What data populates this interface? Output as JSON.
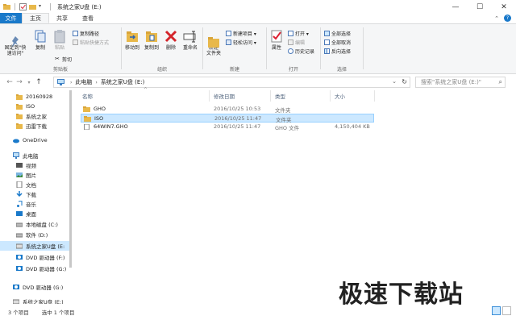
{
  "window": {
    "title": "系统之家U盘 (E:)",
    "controls": [
      "—",
      "☐",
      "✕"
    ]
  },
  "tabs": {
    "file": "文件",
    "home": "主页",
    "share": "共享",
    "view": "查看"
  },
  "ribbon": {
    "clipboard": {
      "group": "剪贴板",
      "pin": "固定到\"快\n速访问\"",
      "copy": "复制",
      "paste": "粘贴",
      "copy_path": "复制路径",
      "paste_shortcut": "粘贴快捷方式",
      "cut": "剪切"
    },
    "organize": {
      "group": "组织",
      "move_to": "移动到",
      "copy_to": "复制到",
      "delete": "删除",
      "rename": "重命名"
    },
    "new": {
      "group": "新建",
      "new_folder": "新建\n文件夹",
      "new_item": "新建项目 ▾",
      "easy_access": "轻松访问 ▾"
    },
    "open": {
      "group": "打开",
      "properties": "属性",
      "open": "打开 ▾",
      "edit": "编辑",
      "history": "历史记录"
    },
    "select": {
      "group": "选择",
      "select_all": "全部选择",
      "select_none": "全部取消",
      "invert": "反向选择"
    }
  },
  "address": {
    "crumbs": [
      "此电脑",
      "系统之家U盘 (E:)"
    ],
    "search_placeholder": "搜索\"系统之家U盘 (E:)\""
  },
  "nav": {
    "items": [
      {
        "label": "20160928",
        "icon": "folder-icon"
      },
      {
        "label": "ISO",
        "icon": "folder-icon"
      },
      {
        "label": "系统之家",
        "icon": "folder-icon"
      },
      {
        "label": "迅雷下载",
        "icon": "folder-icon"
      },
      {
        "label": "OneDrive",
        "icon": "cloud-icon"
      },
      {
        "label": "此电脑",
        "icon": "computer-icon"
      },
      {
        "label": "视频",
        "icon": "video-icon"
      },
      {
        "label": "图片",
        "icon": "pictures-icon"
      },
      {
        "label": "文档",
        "icon": "documents-icon"
      },
      {
        "label": "下载",
        "icon": "download-icon"
      },
      {
        "label": "音乐",
        "icon": "music-icon"
      },
      {
        "label": "桌面",
        "icon": "desktop-icon"
      },
      {
        "label": "本地磁盘 (C:)",
        "icon": "drive-icon"
      },
      {
        "label": "软件 (D:)",
        "icon": "drive-icon"
      },
      {
        "label": "系统之家U盘 (E:",
        "icon": "usb-drive-icon"
      },
      {
        "label": "DVD 驱动器 (F:)",
        "icon": "dvd-icon"
      },
      {
        "label": "DVD 驱动器 (G:)",
        "icon": "dvd-icon"
      },
      {
        "label": "DVD 驱动器 (G:)",
        "icon": "dvd-icon"
      },
      {
        "label": "系统之家U盘 (E:)",
        "icon": "usb-drive-icon"
      }
    ]
  },
  "files": {
    "headers": {
      "name": "名称",
      "date": "修改日期",
      "type": "类型",
      "size": "大小"
    },
    "rows": [
      {
        "name": "GHO",
        "date": "2016/10/25 10:53",
        "type": "文件夹",
        "size": "",
        "icon": "folder-icon",
        "selected": false
      },
      {
        "name": "ISO",
        "date": "2016/10/25 11:47",
        "type": "文件夹",
        "size": "",
        "icon": "folder-icon",
        "selected": true
      },
      {
        "name": "64WIN7.GHO",
        "date": "2016/10/25 11:47",
        "type": "GHO 文件",
        "size": "4,150,404 KB",
        "icon": "file-icon",
        "selected": false
      }
    ]
  },
  "status": {
    "count": "3 个项目",
    "selected": "选中 1 个项目"
  },
  "watermark": "极速下载站",
  "colors": {
    "accent": "#1979ca",
    "selection": "#cce8ff",
    "folder": "#e8b84a"
  }
}
